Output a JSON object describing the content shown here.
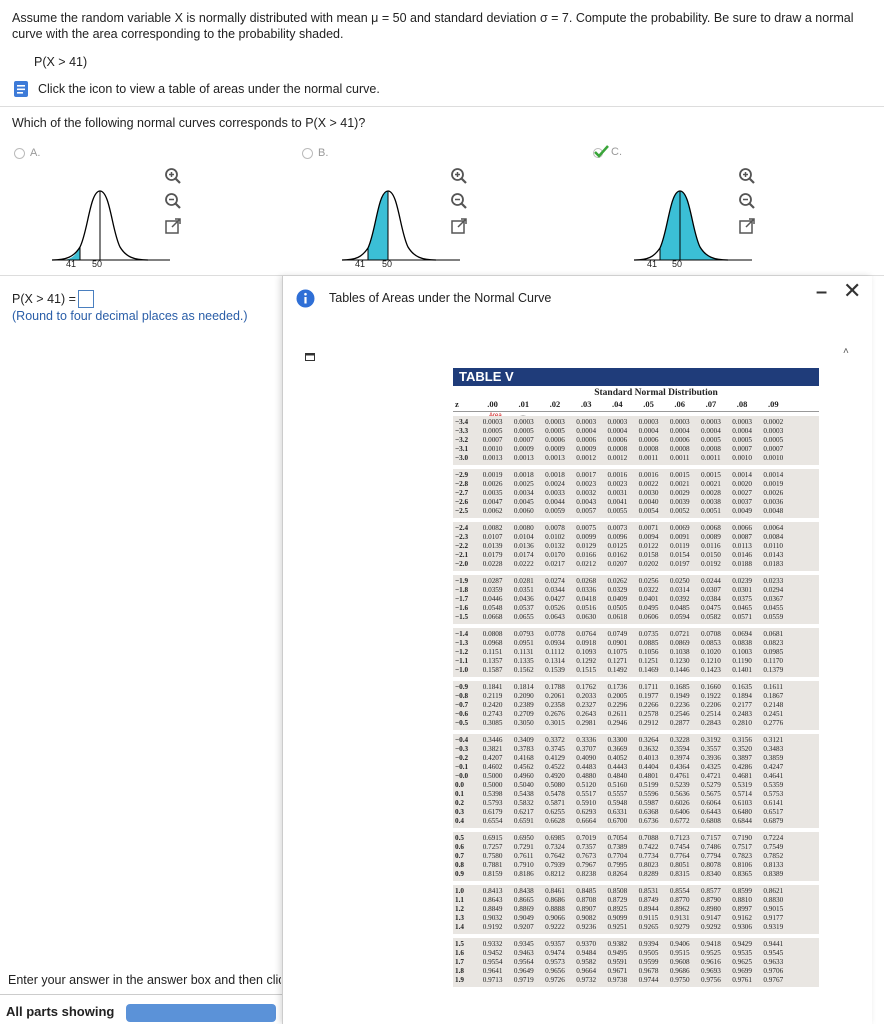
{
  "question": "Assume the random variable X is normally distributed with mean μ = 50 and standard deviation σ = 7. Compute the probability. Be sure to draw a normal curve with the area corresponding to the probability shaded.",
  "probability_expr": "P(X > 41)",
  "table_link_text": "Click the icon to view a table of areas under the normal curve.",
  "which_question": "Which of the following normal curves corresponds to P(X > 41)?",
  "options": [
    {
      "label": "A.",
      "tick_left": "41",
      "tick_right": "50",
      "shade": "left"
    },
    {
      "label": "B.",
      "tick_left": "41",
      "tick_right": "50",
      "shade": "center"
    },
    {
      "label": "C.",
      "tick_left": "41",
      "tick_right": "50",
      "shade": "right",
      "selected": true
    }
  ],
  "answer_label": "P(X > 41) =",
  "round_note": "(Round to four decimal places as needed.)",
  "enter_note": "Enter your answer in the answer box and then click Check Answer.",
  "all_parts": "All parts showing",
  "popup": {
    "title": "Tables of Areas under the Normal Curve",
    "minimize": "–",
    "close": "✕",
    "table_title": "TABLE V",
    "table_caption": "Standard Normal Distribution",
    "area_label": "Area",
    "z_label": "z",
    "col_headers": [
      ".00",
      ".01",
      ".02",
      ".03",
      ".04",
      ".05",
      ".06",
      ".07",
      ".08",
      ".09"
    ],
    "groups": [
      [
        [
          "−3.4",
          "0.0003",
          "0.0003",
          "0.0003",
          "0.0003",
          "0.0003",
          "0.0003",
          "0.0003",
          "0.0003",
          "0.0003",
          "0.0002"
        ],
        [
          "−3.3",
          "0.0005",
          "0.0005",
          "0.0005",
          "0.0004",
          "0.0004",
          "0.0004",
          "0.0004",
          "0.0004",
          "0.0004",
          "0.0003"
        ],
        [
          "−3.2",
          "0.0007",
          "0.0007",
          "0.0006",
          "0.0006",
          "0.0006",
          "0.0006",
          "0.0006",
          "0.0005",
          "0.0005",
          "0.0005"
        ],
        [
          "−3.1",
          "0.0010",
          "0.0009",
          "0.0009",
          "0.0009",
          "0.0008",
          "0.0008",
          "0.0008",
          "0.0008",
          "0.0007",
          "0.0007"
        ],
        [
          "−3.0",
          "0.0013",
          "0.0013",
          "0.0013",
          "0.0012",
          "0.0012",
          "0.0011",
          "0.0011",
          "0.0011",
          "0.0010",
          "0.0010"
        ]
      ],
      [
        [
          "−2.9",
          "0.0019",
          "0.0018",
          "0.0018",
          "0.0017",
          "0.0016",
          "0.0016",
          "0.0015",
          "0.0015",
          "0.0014",
          "0.0014"
        ],
        [
          "−2.8",
          "0.0026",
          "0.0025",
          "0.0024",
          "0.0023",
          "0.0023",
          "0.0022",
          "0.0021",
          "0.0021",
          "0.0020",
          "0.0019"
        ],
        [
          "−2.7",
          "0.0035",
          "0.0034",
          "0.0033",
          "0.0032",
          "0.0031",
          "0.0030",
          "0.0029",
          "0.0028",
          "0.0027",
          "0.0026"
        ],
        [
          "−2.6",
          "0.0047",
          "0.0045",
          "0.0044",
          "0.0043",
          "0.0041",
          "0.0040",
          "0.0039",
          "0.0038",
          "0.0037",
          "0.0036"
        ],
        [
          "−2.5",
          "0.0062",
          "0.0060",
          "0.0059",
          "0.0057",
          "0.0055",
          "0.0054",
          "0.0052",
          "0.0051",
          "0.0049",
          "0.0048"
        ]
      ],
      [
        [
          "−2.4",
          "0.0082",
          "0.0080",
          "0.0078",
          "0.0075",
          "0.0073",
          "0.0071",
          "0.0069",
          "0.0068",
          "0.0066",
          "0.0064"
        ],
        [
          "−2.3",
          "0.0107",
          "0.0104",
          "0.0102",
          "0.0099",
          "0.0096",
          "0.0094",
          "0.0091",
          "0.0089",
          "0.0087",
          "0.0084"
        ],
        [
          "−2.2",
          "0.0139",
          "0.0136",
          "0.0132",
          "0.0129",
          "0.0125",
          "0.0122",
          "0.0119",
          "0.0116",
          "0.0113",
          "0.0110"
        ],
        [
          "−2.1",
          "0.0179",
          "0.0174",
          "0.0170",
          "0.0166",
          "0.0162",
          "0.0158",
          "0.0154",
          "0.0150",
          "0.0146",
          "0.0143"
        ],
        [
          "−2.0",
          "0.0228",
          "0.0222",
          "0.0217",
          "0.0212",
          "0.0207",
          "0.0202",
          "0.0197",
          "0.0192",
          "0.0188",
          "0.0183"
        ]
      ],
      [
        [
          "−1.9",
          "0.0287",
          "0.0281",
          "0.0274",
          "0.0268",
          "0.0262",
          "0.0256",
          "0.0250",
          "0.0244",
          "0.0239",
          "0.0233"
        ],
        [
          "−1.8",
          "0.0359",
          "0.0351",
          "0.0344",
          "0.0336",
          "0.0329",
          "0.0322",
          "0.0314",
          "0.0307",
          "0.0301",
          "0.0294"
        ],
        [
          "−1.7",
          "0.0446",
          "0.0436",
          "0.0427",
          "0.0418",
          "0.0409",
          "0.0401",
          "0.0392",
          "0.0384",
          "0.0375",
          "0.0367"
        ],
        [
          "−1.6",
          "0.0548",
          "0.0537",
          "0.0526",
          "0.0516",
          "0.0505",
          "0.0495",
          "0.0485",
          "0.0475",
          "0.0465",
          "0.0455"
        ],
        [
          "−1.5",
          "0.0668",
          "0.0655",
          "0.0643",
          "0.0630",
          "0.0618",
          "0.0606",
          "0.0594",
          "0.0582",
          "0.0571",
          "0.0559"
        ]
      ],
      [
        [
          "−1.4",
          "0.0808",
          "0.0793",
          "0.0778",
          "0.0764",
          "0.0749",
          "0.0735",
          "0.0721",
          "0.0708",
          "0.0694",
          "0.0681"
        ],
        [
          "−1.3",
          "0.0968",
          "0.0951",
          "0.0934",
          "0.0918",
          "0.0901",
          "0.0885",
          "0.0869",
          "0.0853",
          "0.0838",
          "0.0823"
        ],
        [
          "−1.2",
          "0.1151",
          "0.1131",
          "0.1112",
          "0.1093",
          "0.1075",
          "0.1056",
          "0.1038",
          "0.1020",
          "0.1003",
          "0.0985"
        ],
        [
          "−1.1",
          "0.1357",
          "0.1335",
          "0.1314",
          "0.1292",
          "0.1271",
          "0.1251",
          "0.1230",
          "0.1210",
          "0.1190",
          "0.1170"
        ],
        [
          "−1.0",
          "0.1587",
          "0.1562",
          "0.1539",
          "0.1515",
          "0.1492",
          "0.1469",
          "0.1446",
          "0.1423",
          "0.1401",
          "0.1379"
        ]
      ],
      [
        [
          "−0.9",
          "0.1841",
          "0.1814",
          "0.1788",
          "0.1762",
          "0.1736",
          "0.1711",
          "0.1685",
          "0.1660",
          "0.1635",
          "0.1611"
        ],
        [
          "−0.8",
          "0.2119",
          "0.2090",
          "0.2061",
          "0.2033",
          "0.2005",
          "0.1977",
          "0.1949",
          "0.1922",
          "0.1894",
          "0.1867"
        ],
        [
          "−0.7",
          "0.2420",
          "0.2389",
          "0.2358",
          "0.2327",
          "0.2296",
          "0.2266",
          "0.2236",
          "0.2206",
          "0.2177",
          "0.2148"
        ],
        [
          "−0.6",
          "0.2743",
          "0.2709",
          "0.2676",
          "0.2643",
          "0.2611",
          "0.2578",
          "0.2546",
          "0.2514",
          "0.2483",
          "0.2451"
        ],
        [
          "−0.5",
          "0.3085",
          "0.3050",
          "0.3015",
          "0.2981",
          "0.2946",
          "0.2912",
          "0.2877",
          "0.2843",
          "0.2810",
          "0.2776"
        ]
      ],
      [
        [
          "−0.4",
          "0.3446",
          "0.3409",
          "0.3372",
          "0.3336",
          "0.3300",
          "0.3264",
          "0.3228",
          "0.3192",
          "0.3156",
          "0.3121"
        ],
        [
          "−0.3",
          "0.3821",
          "0.3783",
          "0.3745",
          "0.3707",
          "0.3669",
          "0.3632",
          "0.3594",
          "0.3557",
          "0.3520",
          "0.3483"
        ],
        [
          "−0.2",
          "0.4207",
          "0.4168",
          "0.4129",
          "0.4090",
          "0.4052",
          "0.4013",
          "0.3974",
          "0.3936",
          "0.3897",
          "0.3859"
        ],
        [
          "−0.1",
          "0.4602",
          "0.4562",
          "0.4522",
          "0.4483",
          "0.4443",
          "0.4404",
          "0.4364",
          "0.4325",
          "0.4286",
          "0.4247"
        ],
        [
          "−0.0",
          "0.5000",
          "0.4960",
          "0.4920",
          "0.4880",
          "0.4840",
          "0.4801",
          "0.4761",
          "0.4721",
          "0.4681",
          "0.4641"
        ],
        [
          "0.0",
          "0.5000",
          "0.5040",
          "0.5080",
          "0.5120",
          "0.5160",
          "0.5199",
          "0.5239",
          "0.5279",
          "0.5319",
          "0.5359"
        ],
        [
          "0.1",
          "0.5398",
          "0.5438",
          "0.5478",
          "0.5517",
          "0.5557",
          "0.5596",
          "0.5636",
          "0.5675",
          "0.5714",
          "0.5753"
        ],
        [
          "0.2",
          "0.5793",
          "0.5832",
          "0.5871",
          "0.5910",
          "0.5948",
          "0.5987",
          "0.6026",
          "0.6064",
          "0.6103",
          "0.6141"
        ],
        [
          "0.3",
          "0.6179",
          "0.6217",
          "0.6255",
          "0.6293",
          "0.6331",
          "0.6368",
          "0.6406",
          "0.6443",
          "0.6480",
          "0.6517"
        ],
        [
          "0.4",
          "0.6554",
          "0.6591",
          "0.6628",
          "0.6664",
          "0.6700",
          "0.6736",
          "0.6772",
          "0.6808",
          "0.6844",
          "0.6879"
        ]
      ],
      [
        [
          "0.5",
          "0.6915",
          "0.6950",
          "0.6985",
          "0.7019",
          "0.7054",
          "0.7088",
          "0.7123",
          "0.7157",
          "0.7190",
          "0.7224"
        ],
        [
          "0.6",
          "0.7257",
          "0.7291",
          "0.7324",
          "0.7357",
          "0.7389",
          "0.7422",
          "0.7454",
          "0.7486",
          "0.7517",
          "0.7549"
        ],
        [
          "0.7",
          "0.7580",
          "0.7611",
          "0.7642",
          "0.7673",
          "0.7704",
          "0.7734",
          "0.7764",
          "0.7794",
          "0.7823",
          "0.7852"
        ],
        [
          "0.8",
          "0.7881",
          "0.7910",
          "0.7939",
          "0.7967",
          "0.7995",
          "0.8023",
          "0.8051",
          "0.8078",
          "0.8106",
          "0.8133"
        ],
        [
          "0.9",
          "0.8159",
          "0.8186",
          "0.8212",
          "0.8238",
          "0.8264",
          "0.8289",
          "0.8315",
          "0.8340",
          "0.8365",
          "0.8389"
        ]
      ],
      [
        [
          "1.0",
          "0.8413",
          "0.8438",
          "0.8461",
          "0.8485",
          "0.8508",
          "0.8531",
          "0.8554",
          "0.8577",
          "0.8599",
          "0.8621"
        ],
        [
          "1.1",
          "0.8643",
          "0.8665",
          "0.8686",
          "0.8708",
          "0.8729",
          "0.8749",
          "0.8770",
          "0.8790",
          "0.8810",
          "0.8830"
        ],
        [
          "1.2",
          "0.8849",
          "0.8869",
          "0.8888",
          "0.8907",
          "0.8925",
          "0.8944",
          "0.8962",
          "0.8980",
          "0.8997",
          "0.9015"
        ],
        [
          "1.3",
          "0.9032",
          "0.9049",
          "0.9066",
          "0.9082",
          "0.9099",
          "0.9115",
          "0.9131",
          "0.9147",
          "0.9162",
          "0.9177"
        ],
        [
          "1.4",
          "0.9192",
          "0.9207",
          "0.9222",
          "0.9236",
          "0.9251",
          "0.9265",
          "0.9279",
          "0.9292",
          "0.9306",
          "0.9319"
        ]
      ],
      [
        [
          "1.5",
          "0.9332",
          "0.9345",
          "0.9357",
          "0.9370",
          "0.9382",
          "0.9394",
          "0.9406",
          "0.9418",
          "0.9429",
          "0.9441"
        ],
        [
          "1.6",
          "0.9452",
          "0.9463",
          "0.9474",
          "0.9484",
          "0.9495",
          "0.9505",
          "0.9515",
          "0.9525",
          "0.9535",
          "0.9545"
        ],
        [
          "1.7",
          "0.9554",
          "0.9564",
          "0.9573",
          "0.9582",
          "0.9591",
          "0.9599",
          "0.9608",
          "0.9616",
          "0.9625",
          "0.9633"
        ],
        [
          "1.8",
          "0.9641",
          "0.9649",
          "0.9656",
          "0.9664",
          "0.9671",
          "0.9678",
          "0.9686",
          "0.9693",
          "0.9699",
          "0.9706"
        ],
        [
          "1.9",
          "0.9713",
          "0.9719",
          "0.9726",
          "0.9732",
          "0.9738",
          "0.9744",
          "0.9750",
          "0.9756",
          "0.9761",
          "0.9767"
        ]
      ]
    ]
  },
  "colors": {
    "curve_fill": "#3bbfd6",
    "table_header": "#1f3c7a",
    "link_blue": "#2a5ea8",
    "check_green": "#3aa53a"
  }
}
